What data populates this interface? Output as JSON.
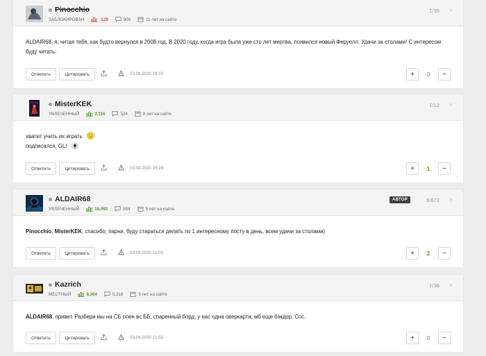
{
  "posts": [
    {
      "username": "Pinocchio",
      "status": "заблокирован",
      "rating": "-129",
      "posts_count": "909",
      "on_site": "11 лет на сайте",
      "position": "1/35",
      "date": "03.04.2020 16:22",
      "score": "0",
      "body": [
        "ALDAIR68, я, читая тебя, как будто вернулся в 2008 год. В 2020 году, когда игра была уже сто лет мертва, появился новый Феруелл. Удачи за столами! С интересом буду читать."
      ]
    },
    {
      "username": "MisterKEK",
      "status": "увлеченный",
      "rating": "3,116",
      "posts_count": "524",
      "on_site": "8 лет на сайте",
      "position": "1/12",
      "date": "03.04.2020 16:28",
      "score": "1",
      "body": [
        "хватит учить их играть",
        "подписался, GL!"
      ]
    },
    {
      "username": "ALDAIR68",
      "status": "увлеченный",
      "rating": "18,092",
      "posts_count": "854",
      "on_site": "5 лет на сайте",
      "badge": "АВТОР",
      "position": "6/672",
      "date": "03.04.2020 21:01",
      "score": "2",
      "body_mentions": [
        "Pinocchio",
        "MisterKEK"
      ],
      "body_text": ", спасибо, парни, буду стараться делать по 1 интересному посту в день, всем удачи за столами)"
    },
    {
      "username": "Kazrich",
      "status": "местный",
      "rating": "8,364",
      "posts_count": "5,218",
      "on_site": "5 лет на сайте",
      "position": "1/36",
      "date": "03.04.2020 21:53",
      "score": "0",
      "body_mention": "ALDAIR68",
      "body_text": ", привет. Разбери мы на СБ опен вс ББ, спаренный борд, у нас одна оверкарта, мб еще бэкдор. Спс."
    }
  ],
  "labels": {
    "reply": "Ответить",
    "quote": "Цитировать",
    "plus": "+",
    "minus": "−",
    "next": "›",
    "separator": ","
  },
  "colors": {
    "negative_rating": "#d9534f",
    "positive_rating": "#4a9a2c",
    "positive_score": "#6b8e00"
  },
  "icons": [
    "rating-icon",
    "comments-icon",
    "calendar-icon",
    "share-icon",
    "warning-icon",
    "smile-emoji-icon",
    "spade-icon"
  ]
}
